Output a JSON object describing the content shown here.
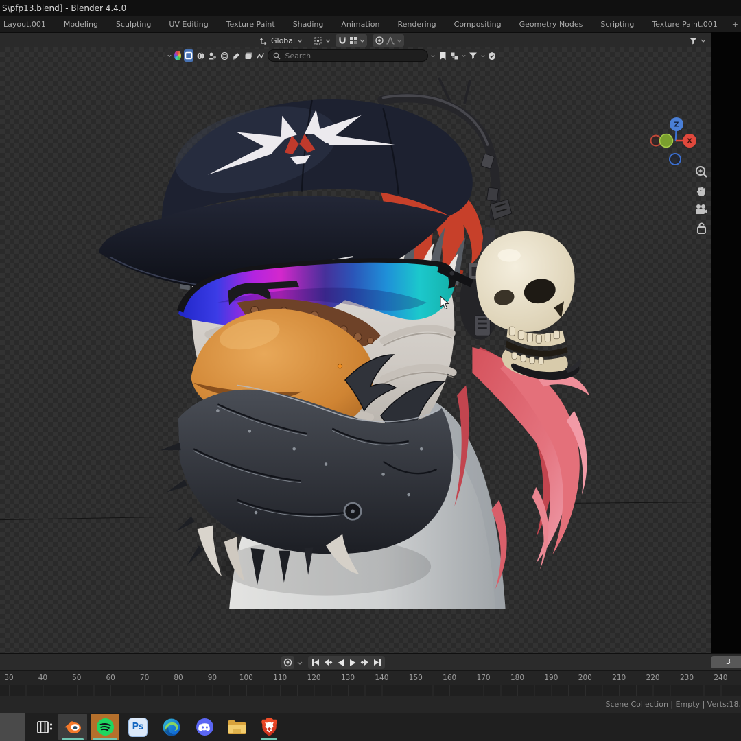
{
  "window": {
    "title": "S\\pfp13.blend] - Blender 4.4.0"
  },
  "workspace_tabs": {
    "items": [
      "Layout.001",
      "Modeling",
      "Sculpting",
      "UV Editing",
      "Texture Paint",
      "Shading",
      "Animation",
      "Rendering",
      "Compositing",
      "Geometry Nodes",
      "Scripting",
      "Texture Paint.001"
    ],
    "add_label": "+"
  },
  "viewport_header": {
    "orientation_label": "Global",
    "icons": [
      "transform-orientation-icon",
      "pivot-point-icon",
      "snap-magnet-icon",
      "snap-target-icon",
      "proportional-editing-icon",
      "falloff-curve-icon",
      "filter-funnel-icon"
    ]
  },
  "overlay_bar": {
    "search_placeholder": "Search",
    "icons": [
      "collapse-chevron-icon",
      "color-wheel-icon",
      "square-toggle-icon",
      "globe-icon",
      "person-icon",
      "sphere-grid-icon",
      "paint-icon",
      "image-stack-icon",
      "curve-icon",
      "bookmark-icon",
      "collection-icon",
      "filter-funnel-icon",
      "shield-check-icon"
    ]
  },
  "gizmo": {
    "z_label": "Z",
    "x_label": "X"
  },
  "viewport_side_icons": [
    "zoom-icon",
    "hand-icon",
    "camera-icon",
    "lock-icon"
  ],
  "timeline": {
    "frame_field": "3",
    "ruler_ticks": [
      30,
      40,
      50,
      60,
      70,
      80,
      90,
      100,
      110,
      120,
      130,
      140,
      150,
      160,
      170,
      180,
      190,
      200,
      210,
      220,
      230,
      240
    ],
    "playback_icons": [
      "jump-to-start-icon",
      "prev-keyframe-icon",
      "play-reverse-icon",
      "play-icon",
      "next-keyframe-icon",
      "jump-to-end-icon"
    ],
    "record_icon": "auto-key-record-icon"
  },
  "status_bar": {
    "text": "Scene Collection | Empty | Verts:18,"
  },
  "taskbar": {
    "apps": [
      "task-view",
      "blender",
      "spotify",
      "photoshop",
      "edge",
      "discord",
      "folder",
      "brave"
    ],
    "active_underline_apps": [
      "blender",
      "spotify",
      "brave"
    ]
  },
  "colors": {
    "selection_blue": "#4772b3",
    "axis_x_red": "#e0483c",
    "axis_y_green": "#7a9f2e",
    "axis_z_blue": "#3b6fd0",
    "taskbar_indicator_teal": "#6fc7b2",
    "viewport_checker_a": "#323232",
    "viewport_checker_b": "#2a2a2a",
    "cap_navy": "#1d2130",
    "beak_orange": "#cf8433",
    "hair_pink": "#e06a70",
    "hair_red": "#c7402a",
    "skull_bone": "#e9e0c9"
  }
}
